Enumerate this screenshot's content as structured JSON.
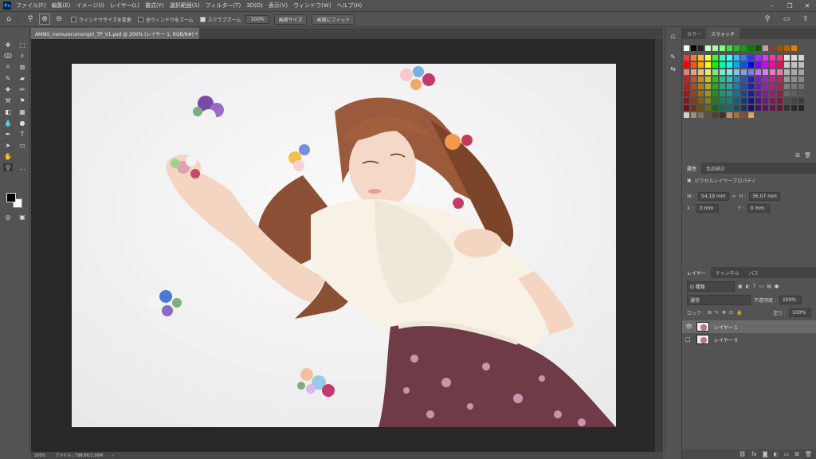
{
  "menu": {
    "items": [
      "ファイル(F)",
      "編集(E)",
      "イメージ(I)",
      "レイヤー(L)",
      "書式(Y)",
      "選択範囲(S)",
      "フィルター(T)",
      "3D(D)",
      "表示(V)",
      "ウィンドウ(W)",
      "ヘルプ(H)"
    ]
  },
  "options": {
    "resize_windows": "ウィンドウサイズを変更",
    "zoom_all": "全ウィンドウをズーム",
    "scrubby_zoom": "スクラブズーム",
    "zoom_value": "100%",
    "fit_screen": "画面サイズ",
    "fill_screen": "画面にフィット"
  },
  "document": {
    "tab_title": "AMI85_nemurerumorigiri_TP_V1.psd @ 200% (レイヤー 1, RGB/8#) *",
    "close": "×"
  },
  "status": {
    "zoom": "200%",
    "file_info": "ファイル : 798.8K/1.56M",
    "arrow": "›"
  },
  "swatches_panel": {
    "tabs": [
      "カラー",
      "スウォッチ"
    ],
    "active": "スウォッチ"
  },
  "properties_panel": {
    "tabs": [
      "属性",
      "色調補正"
    ],
    "header": "ピクセルレイヤープロパティ",
    "w_label": "W :",
    "w_value": "54.19 mm",
    "h_label": "H :",
    "h_value": "36.07 mm",
    "link": "∞",
    "x_label": "X :",
    "x_value": "0 mm",
    "y_label": "Y :",
    "y_value": "0 mm"
  },
  "layers_panel": {
    "tabs": [
      "レイヤー",
      "チャンネル",
      "パス"
    ],
    "kind": "Q 種類",
    "blend": "通常",
    "opacity_label": "不透明度 :",
    "opacity_value": "100%",
    "lock_label": "ロック :",
    "fill_label": "塗り :",
    "fill_value": "100%",
    "layers": [
      {
        "name": "レイヤー 1",
        "visible": true,
        "selected": true
      },
      {
        "name": "レイヤー 0",
        "visible": false,
        "selected": false
      }
    ],
    "footer_icons": [
      "link-icon",
      "fx-icon",
      "mask-icon",
      "adjustment-icon",
      "group-icon",
      "new-layer-icon",
      "trash-icon"
    ]
  },
  "colors": {
    "bg": "#535353",
    "dark": "#282828",
    "accent": "#31a8ff"
  }
}
